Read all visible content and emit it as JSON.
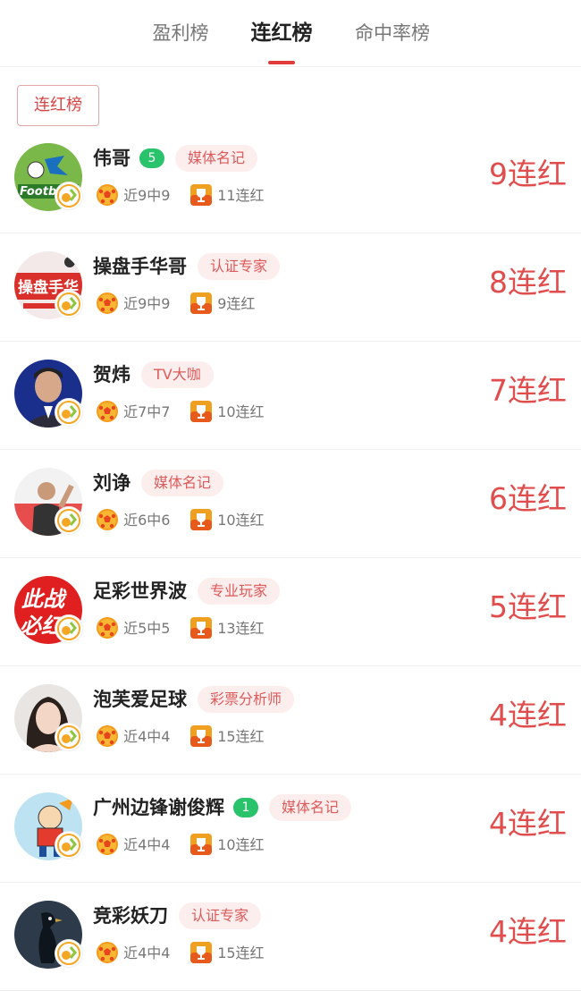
{
  "tabs": [
    {
      "label": "盈利榜",
      "active": false
    },
    {
      "label": "连红榜",
      "active": true
    },
    {
      "label": "命中率榜",
      "active": false
    }
  ],
  "filter": {
    "label": "连红榜"
  },
  "colors": {
    "accent": "#e23b3b",
    "level_badge": "#28c36a",
    "tag_bg": "#fdeeee",
    "tag_text": "#dd5a5a"
  },
  "experts": [
    {
      "name": "伟哥",
      "level": "5",
      "tag": "媒体名记",
      "recent": "近9中9",
      "total": "11连红",
      "streak": "9连红",
      "avatar": "football-logo-avatar"
    },
    {
      "name": "操盘手华哥",
      "level": null,
      "tag": "认证专家",
      "recent": "近9中9",
      "total": "9连红",
      "streak": "8连红",
      "avatar": "banner-text-avatar"
    },
    {
      "name": "贺炜",
      "level": null,
      "tag": "TV大咖",
      "recent": "近7中7",
      "total": "10连红",
      "streak": "7连红",
      "avatar": "man-portrait-avatar"
    },
    {
      "name": "刘诤",
      "level": null,
      "tag": "媒体名记",
      "recent": "近6中6",
      "total": "10连红",
      "streak": "6连红",
      "avatar": "man-waving-avatar"
    },
    {
      "name": "足彩世界波",
      "level": null,
      "tag": "专业玩家",
      "recent": "近5中5",
      "total": "13连红",
      "streak": "5连红",
      "avatar": "red-calligraphy-avatar",
      "avatar_text": "此战必红"
    },
    {
      "name": "泡芙爱足球",
      "level": null,
      "tag": "彩票分析师",
      "recent": "近4中4",
      "total": "15连红",
      "streak": "4连红",
      "avatar": "woman-portrait-avatar"
    },
    {
      "name": "广州边锋谢俊辉",
      "level": "1",
      "tag": "媒体名记",
      "recent": "近4中4",
      "total": "10连红",
      "streak": "4连红",
      "avatar": "cartoon-player-avatar"
    },
    {
      "name": "竞彩妖刀",
      "level": null,
      "tag": "认证专家",
      "recent": "近4中4",
      "total": "15连红",
      "streak": "4连红",
      "avatar": "dark-bird-avatar"
    }
  ]
}
